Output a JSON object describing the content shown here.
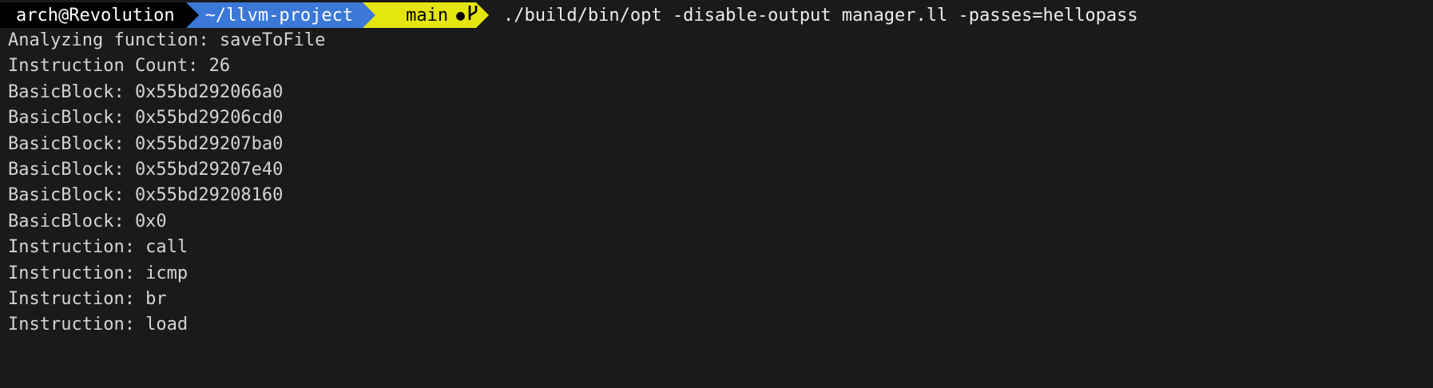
{
  "prompt": {
    "user_host": "arch@Revolution",
    "directory": "~/llvm-project",
    "branch": "main",
    "dirty_indicator": "●",
    "branch_icon": "git-branch-icon",
    "command": "./build/bin/opt -disable-output manager.ll -passes=hellopass"
  },
  "colors": {
    "background": "#1a1a1a",
    "user_segment": "#000000",
    "dir_segment": "#3b78d8",
    "git_segment": "#e5e510",
    "text": "#d4d4d4"
  },
  "output": [
    "Analyzing function: saveToFile",
    "Instruction Count: 26",
    "BasicBlock: 0x55bd292066a0",
    "BasicBlock: 0x55bd29206cd0",
    "BasicBlock: 0x55bd29207ba0",
    "BasicBlock: 0x55bd29207e40",
    "BasicBlock: 0x55bd29208160",
    "BasicBlock: 0x0",
    "Instruction: call",
    "Instruction: icmp",
    "Instruction: br",
    "Instruction: load"
  ]
}
